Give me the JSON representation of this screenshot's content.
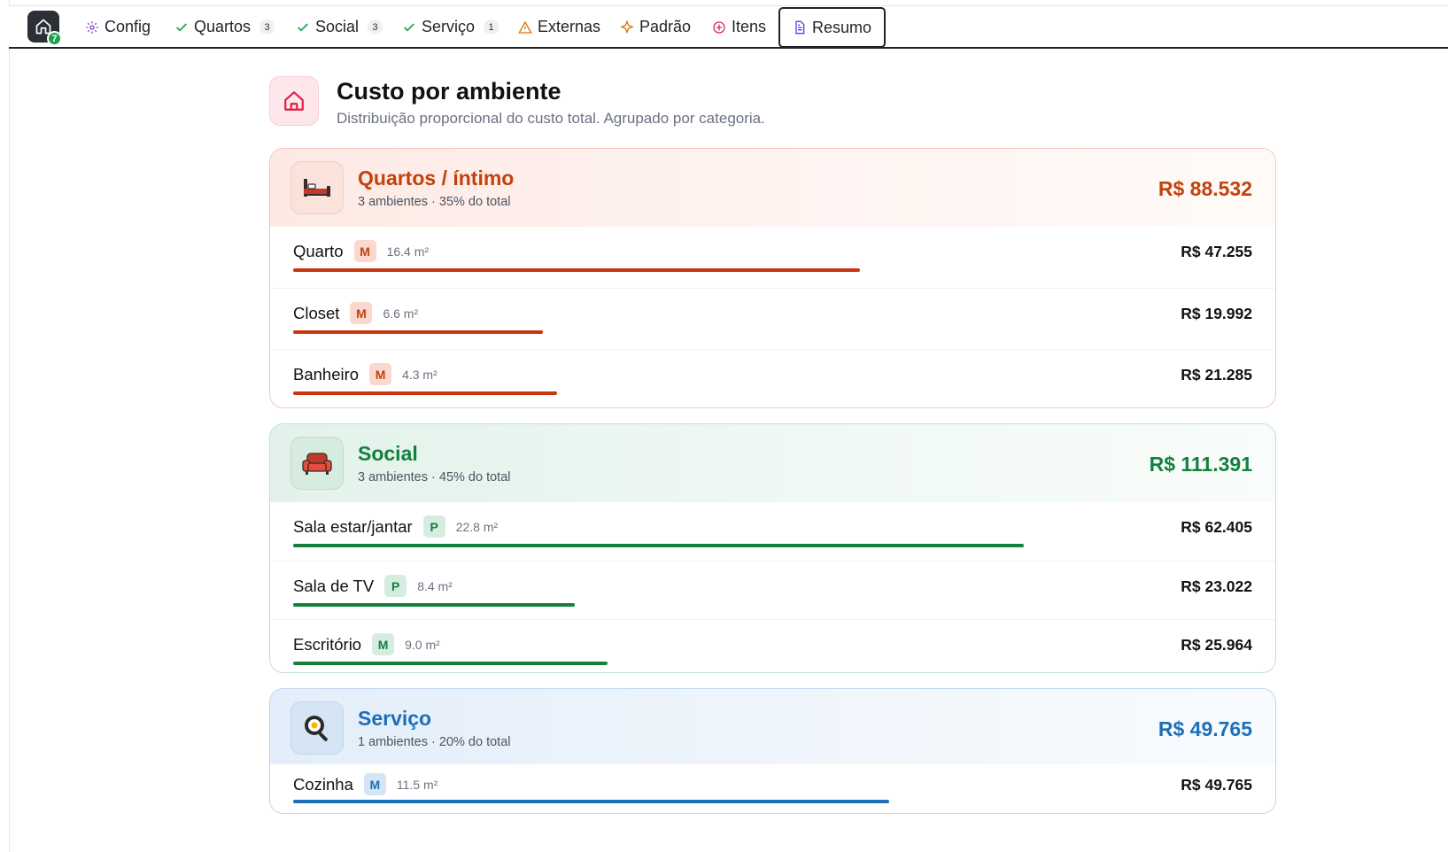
{
  "nav": {
    "home_badge": "7",
    "tabs": [
      {
        "label": "Config",
        "icon": "gear-icon",
        "count": null
      },
      {
        "label": "Quartos",
        "icon": "check-icon",
        "count": "3"
      },
      {
        "label": "Social",
        "icon": "check-icon",
        "count": "3"
      },
      {
        "label": "Serviço",
        "icon": "check-icon",
        "count": "1"
      },
      {
        "label": "Externas",
        "icon": "warning-icon",
        "count": null
      },
      {
        "label": "Padrão",
        "icon": "sparkle-icon",
        "count": null
      },
      {
        "label": "Itens",
        "icon": "plus-circle-icon",
        "count": null
      },
      {
        "label": "Resumo",
        "icon": "document-icon",
        "count": null,
        "active": true
      }
    ]
  },
  "header": {
    "title": "Custo por ambiente",
    "subtitle": "Distribuição proporcional do custo total. Agrupado por categoria."
  },
  "colors": {
    "quartos": "#c2410c",
    "social": "#15803d",
    "servico": "#1d6fb8"
  },
  "categories": [
    {
      "title": "Quartos / íntimo",
      "meta": "3 ambientes · 35% do total",
      "total": "R$ 88.532",
      "icon": "bed-icon",
      "rooms": [
        {
          "name": "Quarto",
          "badge": "M",
          "area": "16.4 m²",
          "value": "R$ 47.255",
          "fraction": 0.59
        },
        {
          "name": "Closet",
          "badge": "M",
          "area": "6.6 m²",
          "value": "R$ 19.992",
          "fraction": 0.26
        },
        {
          "name": "Banheiro",
          "badge": "M",
          "area": "4.3 m²",
          "value": "R$ 21.285",
          "fraction": 0.275
        }
      ]
    },
    {
      "title": "Social",
      "meta": "3 ambientes · 45% do total",
      "total": "R$ 111.391",
      "icon": "sofa-icon",
      "rooms": [
        {
          "name": "Sala estar/jantar",
          "badge": "P",
          "area": "22.8 m²",
          "value": "R$ 62.405",
          "fraction": 0.76
        },
        {
          "name": "Sala de TV",
          "badge": "P",
          "area": "8.4 m²",
          "value": "R$ 23.022",
          "fraction": 0.293
        },
        {
          "name": "Escritório",
          "badge": "M",
          "area": "9.0 m²",
          "value": "R$ 25.964",
          "fraction": 0.327
        }
      ]
    },
    {
      "title": "Serviço",
      "meta": "1 ambientes · 20% do total",
      "total": "R$ 49.765",
      "icon": "frying-pan-icon",
      "rooms": [
        {
          "name": "Cozinha",
          "badge": "M",
          "area": "11.5 m²",
          "value": "R$ 49.765",
          "fraction": 0.62
        }
      ]
    }
  ]
}
